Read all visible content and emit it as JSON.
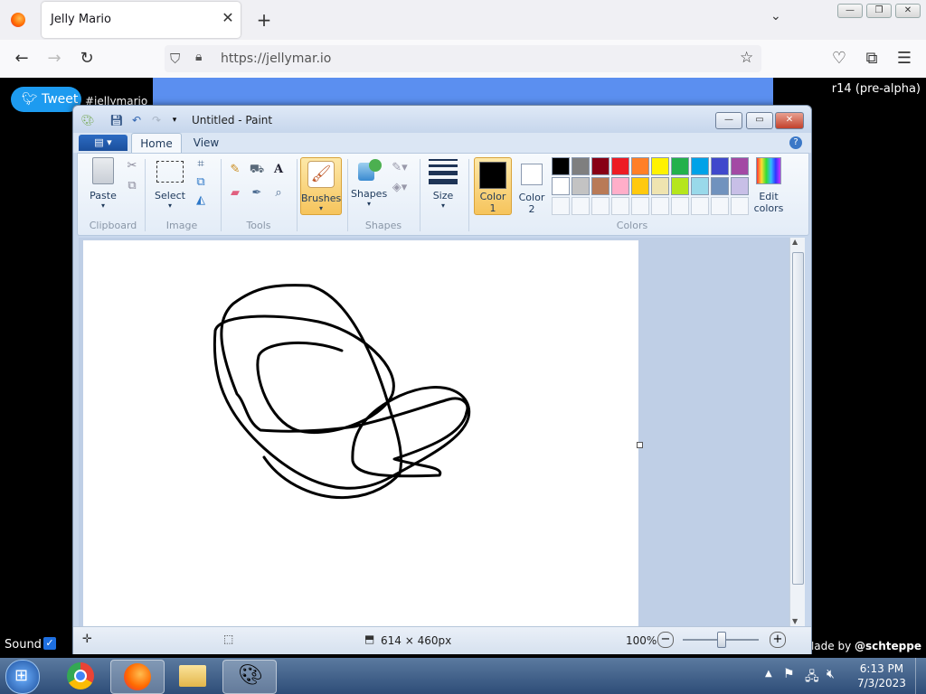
{
  "browser": {
    "tab_title": "Jelly Mario",
    "url": "https://jellymar.io"
  },
  "page": {
    "tweet_label": "Tweet",
    "hashtag": "#jellymario",
    "version": "r14 (pre-alpha)",
    "sound_label": "Sound",
    "sound_checked": true,
    "made_by_prefix": "Made by ",
    "made_by_handle": "@schteppe"
  },
  "paint": {
    "title": "Untitled - Paint",
    "tabs": [
      "Home",
      "View"
    ],
    "groups": {
      "clipboard": "Clipboard",
      "image": "Image",
      "tools": "Tools",
      "shapes": "Shapes",
      "colors": "Colors"
    },
    "buttons": {
      "paste": "Paste",
      "select": "Select",
      "brushes": "Brushes",
      "shapes": "Shapes",
      "size": "Size",
      "color1": "Color\n1",
      "color2": "Color\n2",
      "edit_colors": "Edit\ncolors"
    },
    "color1": "#000000",
    "color2": "#ffffff",
    "palette_row1": [
      "#000000",
      "#7f7f7f",
      "#880015",
      "#ed1c24",
      "#ff7f27",
      "#fff200",
      "#22b14c",
      "#00a2e8",
      "#3f48cc",
      "#a349a4"
    ],
    "palette_row2": [
      "#ffffff",
      "#c3c3c3",
      "#b97a57",
      "#ffaec9",
      "#ffc90e",
      "#efe4b0",
      "#b5e61d",
      "#99d9ea",
      "#7092be",
      "#c8bfe7"
    ],
    "status": {
      "dimensions": "614 × 460px",
      "zoom": "100%"
    }
  },
  "taskbar": {
    "time": "6:13 PM",
    "date": "7/3/2023"
  }
}
